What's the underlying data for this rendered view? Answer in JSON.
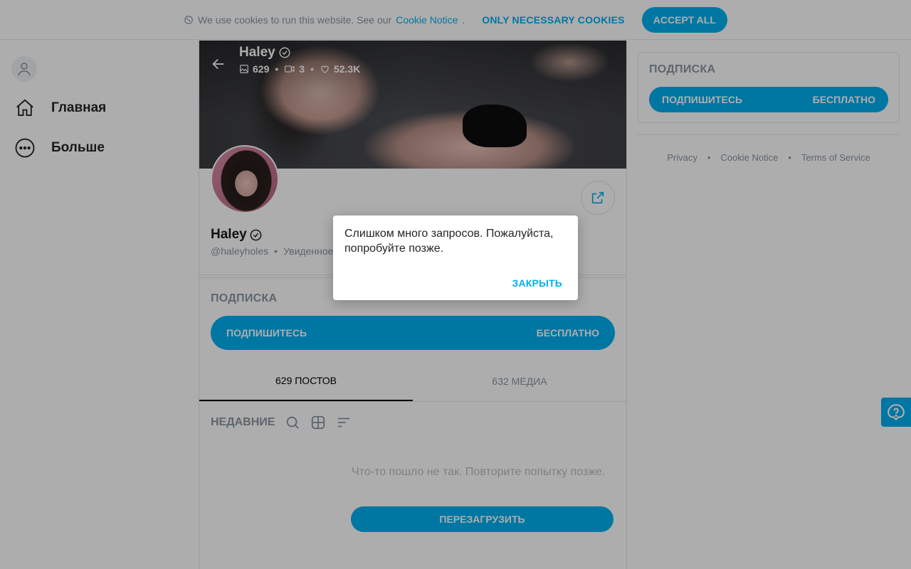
{
  "cookie_bar": {
    "text": "We use cookies to run this website. See our",
    "link": "Cookie Notice",
    "period": ".",
    "necessary_label": "ONLY NECESSARY COOKIES",
    "accept_label": "ACCEPT ALL"
  },
  "nav": {
    "home_label": "Главная",
    "more_label": "Больше"
  },
  "cover": {
    "name": "Haley",
    "photos": "629",
    "videos": "3",
    "likes": "52.3K"
  },
  "profile": {
    "name": "Haley",
    "handle": "@haleyholes",
    "last_seen": "Увиденное"
  },
  "subscription": {
    "title": "ПОДПИСКА",
    "subscribe_label": "ПОДПИШИТЕСЬ",
    "price_label": "БЕСПЛАТНО"
  },
  "tabs": [
    {
      "label": "629 ПОСТОВ",
      "active": true
    },
    {
      "label": "632 МЕДИА",
      "active": false
    }
  ],
  "filters": {
    "label": "НЕДАВНИЕ"
  },
  "feed": {
    "error": "Что-то пошло не так. Повторите попытку позже.",
    "reload_label": "ПЕРЕЗАГРУЗИТЬ"
  },
  "sidebar": {
    "title": "ПОДПИСКА",
    "subscribe_label": "ПОДПИШИТЕСЬ",
    "price_label": "БЕСПЛАТНО"
  },
  "footer": {
    "privacy": "Privacy",
    "cookie_notice": "Cookie Notice",
    "terms": "Terms of Service",
    "dot": "•"
  },
  "dialog": {
    "message": "Слишком много запросов. Пожалуйста, попробуйте позже.",
    "close_label": "ЗАКРЫТЬ"
  },
  "colors": {
    "accent": "#00aff0",
    "muted": "#8a96a3",
    "overlay": "rgba(0,0,0,0.32)"
  }
}
